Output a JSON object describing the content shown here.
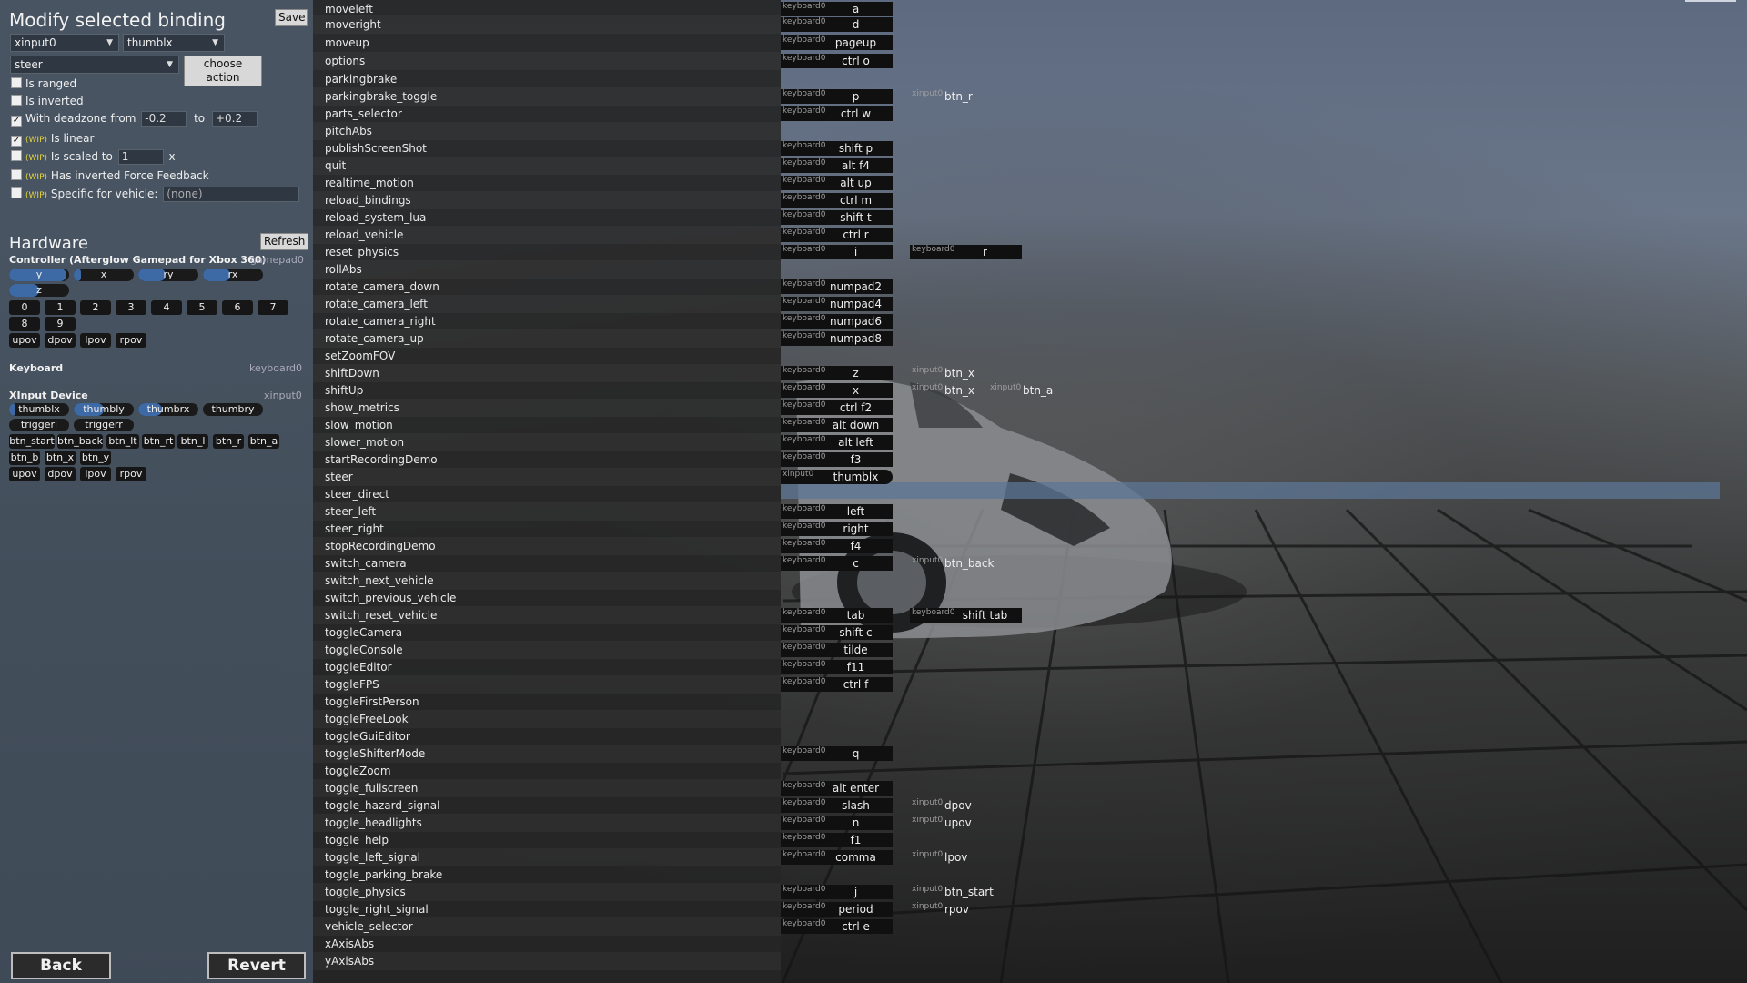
{
  "modify": {
    "title": "Modify selected binding",
    "save_label": "Save",
    "device_select": "xinput0",
    "control_select": "thumblx",
    "action_select": "steer",
    "choose_action_label": "choose action",
    "options": [
      {
        "label": "Is ranged",
        "checked": false,
        "wip": false
      },
      {
        "label": "Is inverted",
        "checked": false,
        "wip": false
      },
      {
        "label": "With deadzone from",
        "checked": true,
        "wip": false,
        "from": "-0.2",
        "to_label": "to",
        "to": "+0.2"
      },
      {
        "label": "Is linear",
        "checked": true,
        "wip": true
      },
      {
        "label": "Is scaled to",
        "checked": false,
        "wip": true,
        "value": "1",
        "suffix": "x"
      },
      {
        "label": "Has inverted Force Feedback",
        "checked": false,
        "wip": true
      },
      {
        "label": "Specific for vehicle:",
        "checked": false,
        "wip": true,
        "value": "(none)"
      }
    ],
    "wip_tag": "(WIP)"
  },
  "hardware": {
    "title": "Hardware",
    "refresh_label": "Refresh",
    "controller": {
      "name": "Controller (Afterglow Gamepad for Xbox 360)",
      "id": "gamepad0",
      "axes": [
        {
          "label": "y",
          "level": 0.95
        },
        {
          "label": "x",
          "level": 0.1
        },
        {
          "label": "ry",
          "level": 0.45
        },
        {
          "label": "rx",
          "level": 0.45
        },
        {
          "label": "z",
          "level": 0.5
        }
      ],
      "buttons": [
        "0",
        "1",
        "2",
        "3",
        "4",
        "5",
        "6",
        "7",
        "8",
        "9"
      ],
      "povs": [
        "upov",
        "dpov",
        "lpov",
        "rpov"
      ]
    },
    "keyboard": {
      "name": "Keyboard",
      "id": "keyboard0"
    },
    "xinput": {
      "name": "XInput Device",
      "id": "xinput0",
      "axes": [
        {
          "label": "thumblx",
          "level": 0.1
        },
        {
          "label": "thumbly",
          "level": 0.5
        },
        {
          "label": "thumbrx",
          "level": 0.4
        },
        {
          "label": "thumbry",
          "level": 0.0
        }
      ],
      "triggers": [
        "triggerl",
        "triggerr"
      ],
      "buttons_row1": [
        "btn_start",
        "btn_back",
        "btn_lt",
        "btn_rt",
        "btn_l",
        "btn_r",
        "btn_a"
      ],
      "buttons_row2": [
        "btn_b",
        "btn_x",
        "btn_y"
      ],
      "povs": [
        "upov",
        "dpov",
        "lpov",
        "rpov"
      ]
    }
  },
  "footer": {
    "back_label": "Back",
    "revert_label": "Revert"
  },
  "actions": [
    {
      "name": "moveleft",
      "b1": {
        "dev": "keyboard0",
        "key": "a"
      }
    },
    {
      "name": "moveright",
      "b1": {
        "dev": "keyboard0",
        "key": "d"
      }
    },
    {
      "name": "moveup",
      "b1": {
        "dev": "keyboard0",
        "key": "pageup"
      }
    },
    {
      "name": "options",
      "b1": {
        "dev": "keyboard0",
        "key": "ctrl o"
      }
    },
    {
      "name": "parkingbrake"
    },
    {
      "name": "parkingbrake_toggle",
      "b1": {
        "dev": "keyboard0",
        "key": "p"
      },
      "b2": {
        "dev": "xinput0",
        "key": "btn_r"
      }
    },
    {
      "name": "parts_selector",
      "b1": {
        "dev": "keyboard0",
        "key": "ctrl w"
      }
    },
    {
      "name": "pitchAbs"
    },
    {
      "name": "publishScreenShot",
      "b1": {
        "dev": "keyboard0",
        "key": "shift p"
      }
    },
    {
      "name": "quit",
      "b1": {
        "dev": "keyboard0",
        "key": "alt f4"
      }
    },
    {
      "name": "realtime_motion",
      "b1": {
        "dev": "keyboard0",
        "key": "alt up"
      }
    },
    {
      "name": "reload_bindings",
      "b1": {
        "dev": "keyboard0",
        "key": "ctrl m"
      }
    },
    {
      "name": "reload_system_lua",
      "b1": {
        "dev": "keyboard0",
        "key": "shift t"
      }
    },
    {
      "name": "reload_vehicle",
      "b1": {
        "dev": "keyboard0",
        "key": "ctrl r"
      }
    },
    {
      "name": "reset_physics",
      "b1": {
        "dev": "keyboard0",
        "key": "i"
      },
      "b2": {
        "dev": "keyboard0",
        "key": "r"
      }
    },
    {
      "name": "rollAbs"
    },
    {
      "name": "rotate_camera_down",
      "b1": {
        "dev": "keyboard0",
        "key": "numpad2"
      }
    },
    {
      "name": "rotate_camera_left",
      "b1": {
        "dev": "keyboard0",
        "key": "numpad4"
      }
    },
    {
      "name": "rotate_camera_right",
      "b1": {
        "dev": "keyboard0",
        "key": "numpad6"
      }
    },
    {
      "name": "rotate_camera_up",
      "b1": {
        "dev": "keyboard0",
        "key": "numpad8"
      }
    },
    {
      "name": "setZoomFOV"
    },
    {
      "name": "shiftDown",
      "b1": {
        "dev": "keyboard0",
        "key": "z"
      },
      "b2": {
        "dev": "xinput0",
        "key": "btn_x"
      }
    },
    {
      "name": "shiftUp",
      "b1": {
        "dev": "keyboard0",
        "key": "x"
      },
      "b2": {
        "dev": "xinput0",
        "key": "btn_x"
      },
      "b3": {
        "dev": "xinput0",
        "key": "btn_a"
      }
    },
    {
      "name": "show_metrics",
      "b1": {
        "dev": "keyboard0",
        "key": "ctrl f2"
      }
    },
    {
      "name": "slow_motion",
      "b1": {
        "dev": "keyboard0",
        "key": "alt down"
      }
    },
    {
      "name": "slower_motion",
      "b1": {
        "dev": "keyboard0",
        "key": "alt left"
      }
    },
    {
      "name": "startRecordingDemo",
      "b1": {
        "dev": "keyboard0",
        "key": "f3"
      }
    },
    {
      "name": "steer",
      "b1": {
        "dev": "xinput0",
        "key": "thumblx"
      },
      "selected": true
    },
    {
      "name": "steer_direct"
    },
    {
      "name": "steer_left",
      "b1": {
        "dev": "keyboard0",
        "key": "left"
      }
    },
    {
      "name": "steer_right",
      "b1": {
        "dev": "keyboard0",
        "key": "right"
      }
    },
    {
      "name": "stopRecordingDemo",
      "b1": {
        "dev": "keyboard0",
        "key": "f4"
      }
    },
    {
      "name": "switch_camera",
      "b1": {
        "dev": "keyboard0",
        "key": "c"
      },
      "b2": {
        "dev": "xinput0",
        "key": "btn_back"
      }
    },
    {
      "name": "switch_next_vehicle"
    },
    {
      "name": "switch_previous_vehicle"
    },
    {
      "name": "switch_reset_vehicle",
      "b1": {
        "dev": "keyboard0",
        "key": "tab"
      },
      "b2": {
        "dev": "keyboard0",
        "key": "shift tab"
      }
    },
    {
      "name": "toggleCamera",
      "b1": {
        "dev": "keyboard0",
        "key": "shift c"
      }
    },
    {
      "name": "toggleConsole",
      "b1": {
        "dev": "keyboard0",
        "key": "tilde"
      }
    },
    {
      "name": "toggleEditor",
      "b1": {
        "dev": "keyboard0",
        "key": "f11"
      }
    },
    {
      "name": "toggleFPS",
      "b1": {
        "dev": "keyboard0",
        "key": "ctrl f"
      }
    },
    {
      "name": "toggleFirstPerson"
    },
    {
      "name": "toggleFreeLook"
    },
    {
      "name": "toggleGuiEditor"
    },
    {
      "name": "toggleShifterMode",
      "b1": {
        "dev": "keyboard0",
        "key": "q"
      }
    },
    {
      "name": "toggleZoom"
    },
    {
      "name": "toggle_fullscreen",
      "b1": {
        "dev": "keyboard0",
        "key": "alt enter"
      }
    },
    {
      "name": "toggle_hazard_signal",
      "b1": {
        "dev": "keyboard0",
        "key": "slash"
      },
      "b2": {
        "dev": "xinput0",
        "key": "dpov"
      }
    },
    {
      "name": "toggle_headlights",
      "b1": {
        "dev": "keyboard0",
        "key": "n"
      },
      "b2": {
        "dev": "xinput0",
        "key": "upov"
      }
    },
    {
      "name": "toggle_help",
      "b1": {
        "dev": "keyboard0",
        "key": "f1"
      }
    },
    {
      "name": "toggle_left_signal",
      "b1": {
        "dev": "keyboard0",
        "key": "comma"
      },
      "b2": {
        "dev": "xinput0",
        "key": "lpov"
      }
    },
    {
      "name": "toggle_parking_brake"
    },
    {
      "name": "toggle_physics",
      "b1": {
        "dev": "keyboard0",
        "key": "j"
      },
      "b2": {
        "dev": "xinput0",
        "key": "btn_start"
      }
    },
    {
      "name": "toggle_right_signal",
      "b1": {
        "dev": "keyboard0",
        "key": "period"
      },
      "b2": {
        "dev": "xinput0",
        "key": "rpov"
      }
    },
    {
      "name": "vehicle_selector",
      "b1": {
        "dev": "keyboard0",
        "key": "ctrl e"
      }
    },
    {
      "name": "xAxisAbs"
    },
    {
      "name": "yAxisAbs"
    }
  ]
}
